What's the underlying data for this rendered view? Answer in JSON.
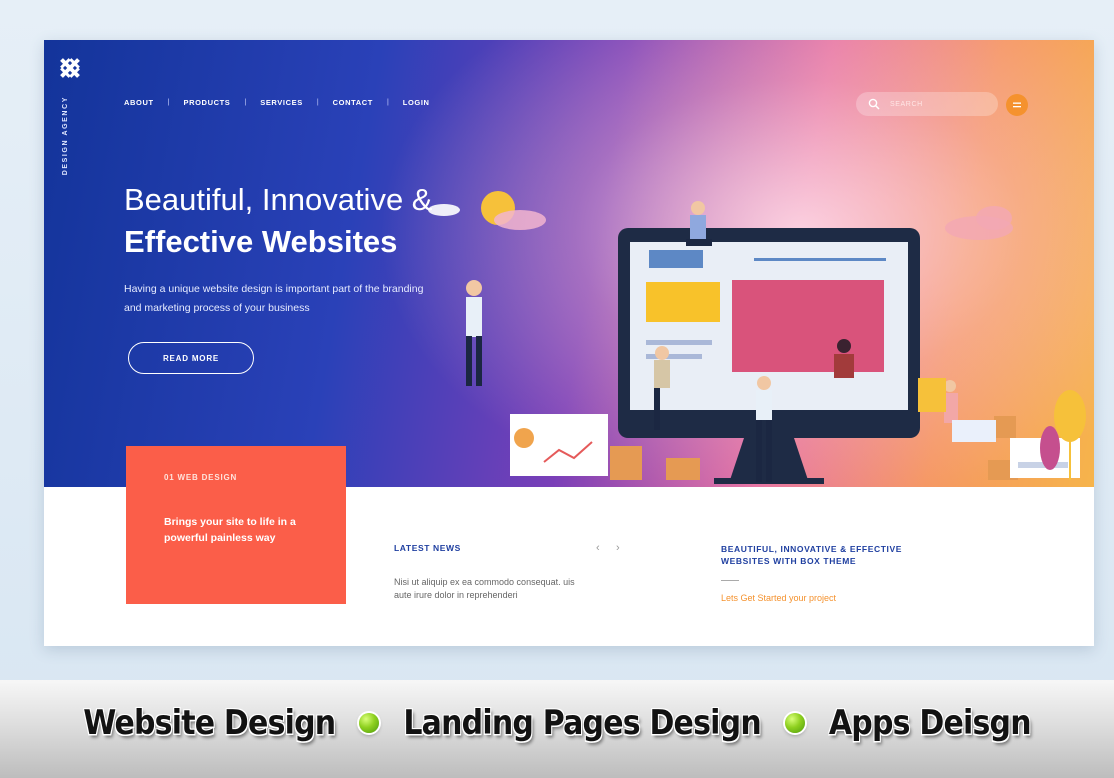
{
  "brand": {
    "vertical_label": "DESIGN AGENCY",
    "logo_icon": "brand-logo-icon"
  },
  "nav": {
    "items": [
      "ABOUT",
      "PRODUCTS",
      "SERVICES",
      "CONTACT",
      "LOGIN"
    ]
  },
  "search": {
    "placeholder": "SEARCH",
    "icon": "search-icon"
  },
  "menu": {
    "icon": "menu-icon"
  },
  "hero": {
    "title_line1": "Beautiful, Innovative &",
    "title_line2": "Effective Websites",
    "description": "Having a unique website design is important part of the branding and marketing process of your business",
    "cta_label": "READ MORE"
  },
  "card": {
    "label": "01 WEB DESIGN",
    "text": "Brings your site to life in a powerful painless way"
  },
  "news": {
    "title": "LATEST NEWS",
    "prev": "‹",
    "next": "›",
    "text": "Nisi ut aliquip ex ea commodo consequat. uis aute irure dolor in reprehenderi"
  },
  "theme": {
    "title": "BEAUTIFUL, INNOVATIVE & EFFECTIVE WEBSITES WITH BOX THEME",
    "link": "Lets Get Started your project"
  },
  "banner": {
    "items": [
      "Website Design",
      "Landing Pages Design",
      "Apps Deisgn"
    ]
  },
  "colors": {
    "accent_orange": "#f5922e",
    "card_coral": "#fb5e49",
    "hero_blue": "#13349a",
    "heading_blue": "#1f3fa0",
    "bullet_green": "#8ed01f"
  }
}
